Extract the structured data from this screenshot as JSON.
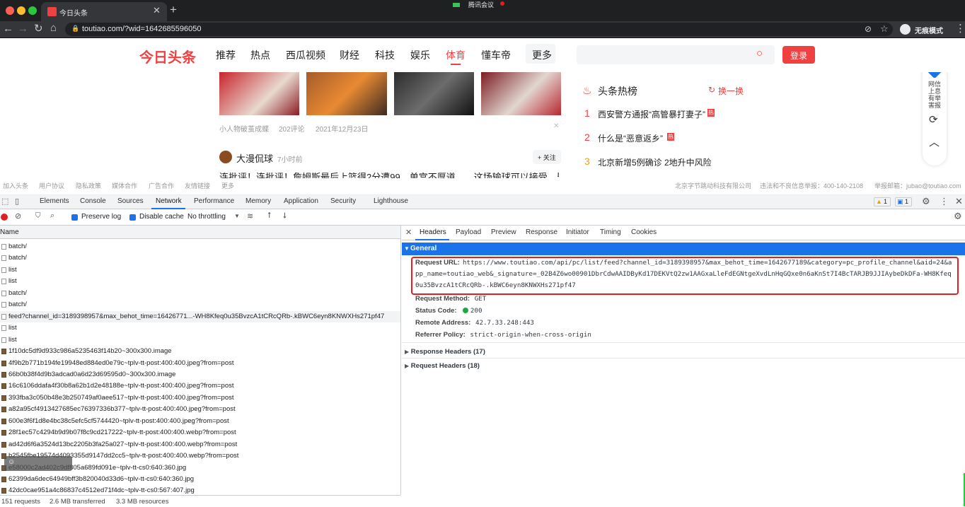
{
  "browser": {
    "tab_title": "今日头条",
    "meeting": "腾讯会议",
    "url": "toutiao.com/?wid=1642685596050",
    "incognito": "无痕模式",
    "icons": [
      "back-icon",
      "forward-icon",
      "reload-icon",
      "home-icon",
      "lock-icon",
      "eye-off-icon",
      "star-icon",
      "avatar-icon",
      "more-icon"
    ]
  },
  "site": {
    "logo": "今日头条",
    "nav": [
      "推荐",
      "热点",
      "西瓜视频",
      "财经",
      "科技",
      "娱乐",
      "体育",
      "懂车帝",
      "更多"
    ],
    "active_nav": "体育",
    "login": "登录",
    "article_meta": {
      "author": "小人物破茧成蝶",
      "comments": "202评论",
      "date": "2021年12月23日"
    },
    "post_author": "大漫侃球",
    "post_time": "7小时前",
    "follow": "+ 关注",
    "post_snippet": "连批评！连批评！詹姆斯最后上篮得2分遭99，单宫不厚道……这场输球可以接受，毕",
    "hot_title": "头条热榜",
    "refresh": "换一换",
    "hot": [
      {
        "rank": "1",
        "text": "西安警方通报“高管暴打妻子”",
        "badge": "热"
      },
      {
        "rank": "2",
        "text": "什么是“恶意返乡”",
        "badge": "热"
      },
      {
        "rank": "3",
        "text": "北京新增5例确诊 2地升中风险",
        "badge": ""
      }
    ],
    "side": {
      "report": "网信 上息 有举 害报"
    },
    "footer_left": [
      "加入头条",
      "用户协议",
      "隐私政策",
      "媒体合作",
      "广告合作",
      "友情链接",
      "更多"
    ],
    "footer_right": [
      "北京字节跳动科技有限公司",
      "违法和不良信息举报：400-140-2108",
      "举报邮箱：jubao@toutiao.com"
    ]
  },
  "devtools": {
    "tabs": [
      "Elements",
      "Console",
      "Sources",
      "Network",
      "Performance",
      "Memory",
      "Application",
      "Security",
      "Lighthouse"
    ],
    "active_tab": "Network",
    "warn": "1",
    "msg": "1",
    "net_opts": {
      "preserve": "Preserve log",
      "disable": "Disable cache",
      "throttle": "No throttling"
    },
    "col_name": "Name",
    "rows": [
      {
        "name": "batch/",
        "img": false
      },
      {
        "name": "batch/",
        "img": false
      },
      {
        "name": "list",
        "img": false
      },
      {
        "name": "list",
        "img": false
      },
      {
        "name": "batch/",
        "img": false
      },
      {
        "name": "batch/",
        "img": false
      },
      {
        "name": "feed?channel_id=3189398957&max_behot_time=16426771...-WH8Kfeq0u35BvzcA1tCRcQRb-.kBWC6eyn8KNWXHs271pf47",
        "img": false
      },
      {
        "name": "list",
        "img": false
      },
      {
        "name": "list",
        "img": false
      },
      {
        "name": "1f10dc5df9d933c986a5235463f14b20~300x300.image",
        "img": true
      },
      {
        "name": "4f9b2b771b194fe19948ed884ed0e79c~tplv-tt-post:400:400.jpeg?from=post",
        "img": true
      },
      {
        "name": "66b0b38f4d9b3adcad0a6d23d69595d0~300x300.image",
        "img": true
      },
      {
        "name": "16c6106ddafa4f30b8a62b1d2e48188e~tplv-tt-post:400:400.jpeg?from=post",
        "img": true
      },
      {
        "name": "393fba3c050b48e3b250749af0aee517~tplv-tt-post:400:400.jpeg?from=post",
        "img": true
      },
      {
        "name": "a82a95cf4913427685ec76397336b377~tplv-tt-post:400:400.jpeg?from=post",
        "img": true
      },
      {
        "name": "600e3f6f1d8e4bc38c5efc5cf5744420~tplv-tt-post:400:400.jpeg?from=post",
        "img": true
      },
      {
        "name": "28f1ec57c4294b9d9b07f8c9cd217222~tplv-tt-post:400:400.webp?from=post",
        "img": true
      },
      {
        "name": "ad42d6f6a3524d13bc2205b3fa25a027~tplv-tt-post:400:400.webp?from=post",
        "img": true
      },
      {
        "name": "b2545fbe19574d4093355d9147dd2cc5~tplv-tt-post:400:400.webp?from=post",
        "img": true
      },
      {
        "name": "e58000c2ad402c9df805a689fd091e~tplv-tt-cs0:640:360.jpg",
        "img": true
      },
      {
        "name": "62399da6dec64949bff3b820040d33d6~tplv-tt-cs0:640:360.jpg",
        "img": true
      },
      {
        "name": "42dc0cae951a4c86837c4512ed71f4dc~tplv-tt-cs0:567:407.jpg",
        "img": true
      }
    ],
    "status": {
      "requests": "151 requests",
      "transferred": "2.6 MB transferred",
      "resources": "3.3 MB resources"
    },
    "detail_tabs": [
      "Headers",
      "Payload",
      "Preview",
      "Response",
      "Initiator",
      "Timing",
      "Cookies"
    ],
    "active_detail": "Headers",
    "general": "General",
    "request_url_label": "Request URL:",
    "request_url_lines": [
      "https://www.toutiao.com/api/pc/list/feed?channel_id=3189398957&max_behot_time=1642677189&category=pc_profile_channel&aid=24&a",
      "pp_name=toutiao_web&_signature=_02B4Z6wo00901DbrCdwAAIDByKd17DEKVtQ2zw1AAGxaLleFdEGNtgeXvdLnHqGQxe0n6aKnSt7I4BcTARJB9JJIAybeDkDFa-WH8Kfeq",
      "0u35BvzcA1tCRcQRb-.kBWC6eyn8KNWXHs271pf47"
    ],
    "method_label": "Request Method:",
    "method": "GET",
    "status_label": "Status Code:",
    "status_code": "200",
    "remote_label": "Remote Address:",
    "remote": "42.7.33.248:443",
    "referrer_label": "Referrer Policy:",
    "referrer": "strict-origin-when-cross-origin",
    "resp_headers": "Response Headers (17)",
    "req_headers": "Request Headers (18)",
    "colors": {
      "accent": "#f04142",
      "devtools_blue": "#1a73e8",
      "highlight": "#e02020"
    }
  }
}
